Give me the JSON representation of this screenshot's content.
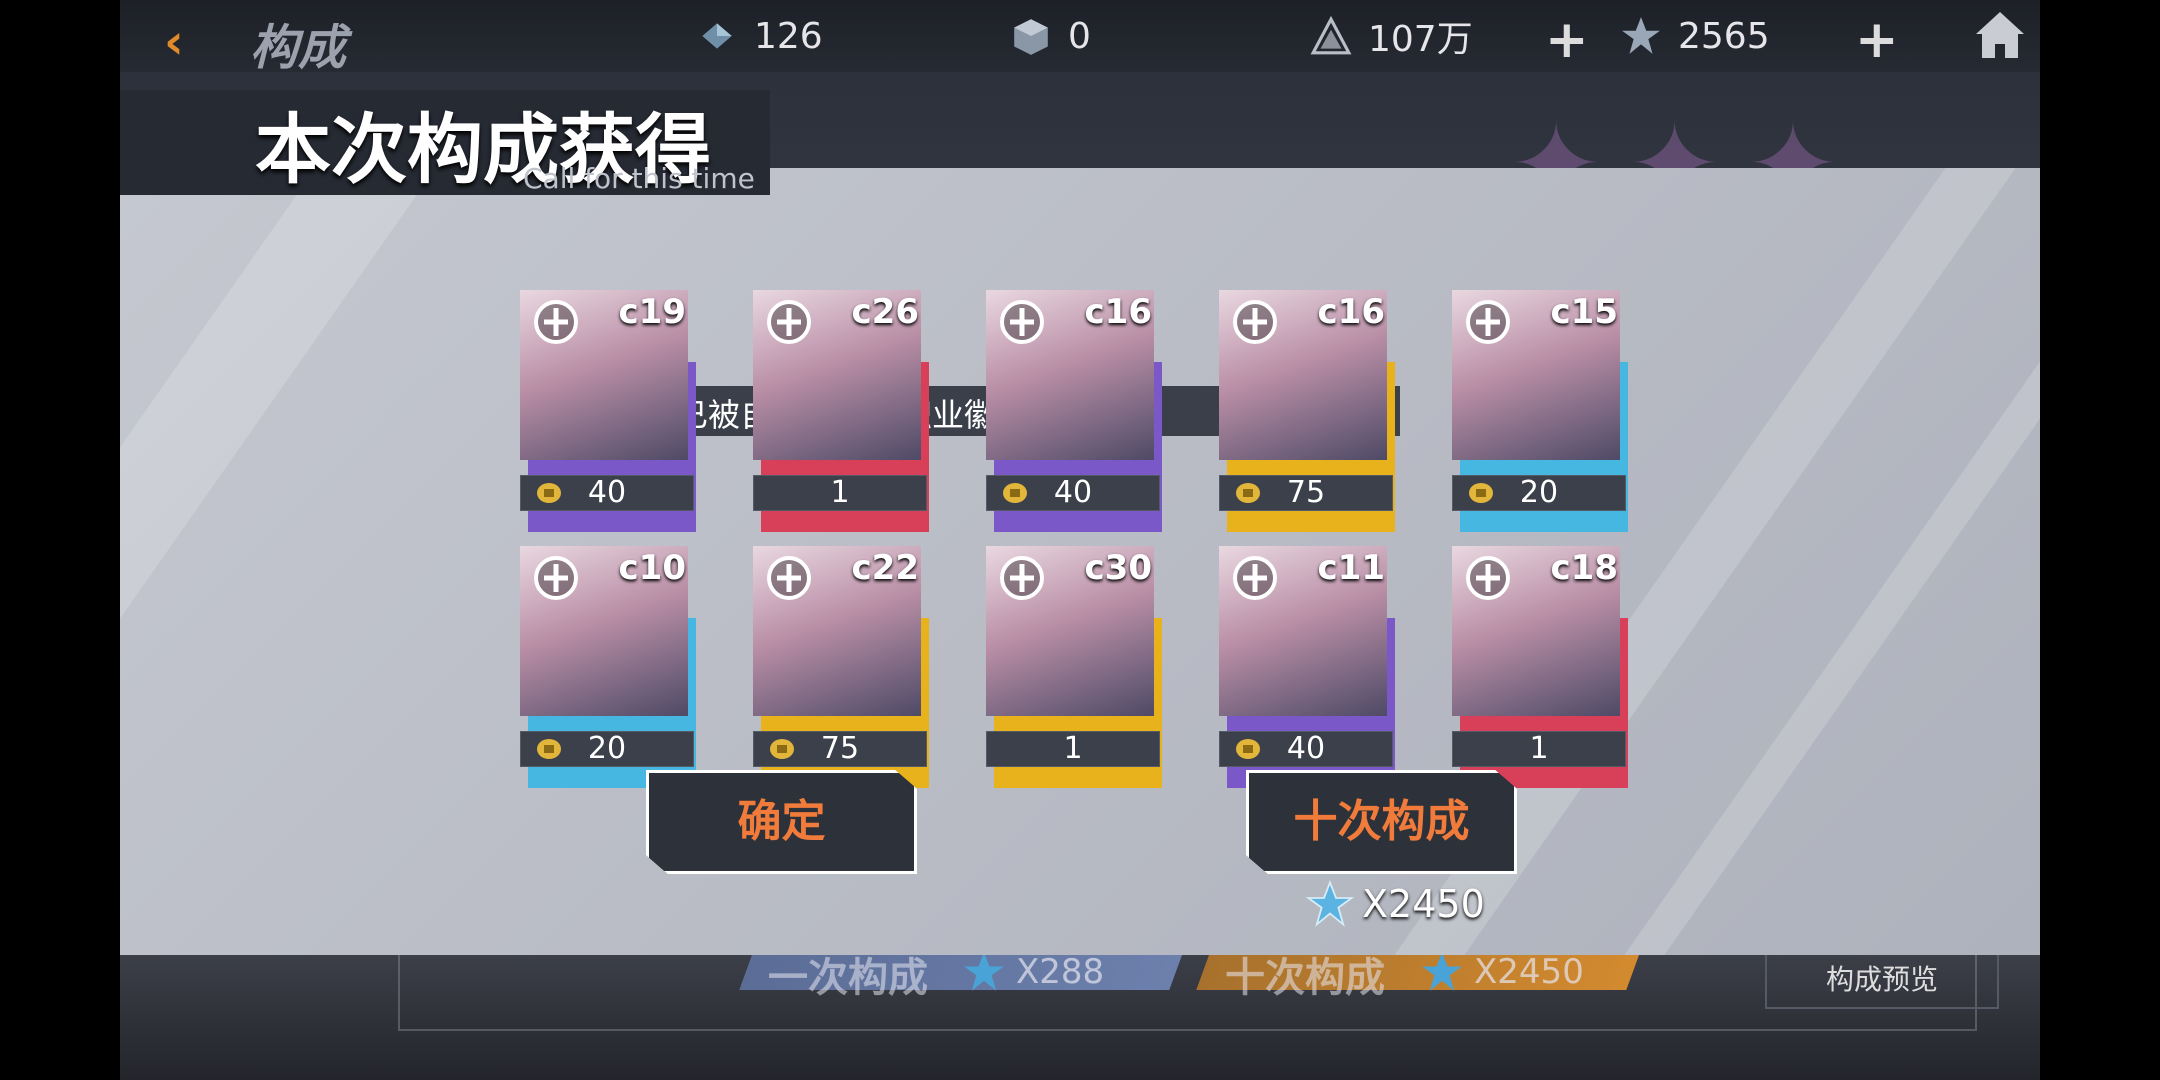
{
  "topbar": {
    "title": "构成",
    "resources": [
      {
        "icon": "crystal-icon",
        "value": "126"
      },
      {
        "icon": "cube-icon",
        "value": "0"
      },
      {
        "icon": "pyramid-coin-icon",
        "value": "107万"
      },
      {
        "icon": "star-crystal-icon",
        "value": "2565"
      }
    ]
  },
  "background": {
    "single_label": "一次构成",
    "single_cost": "X288",
    "ten_label": "十次构成",
    "ten_cost": "X2450",
    "preview_label": "构成预览"
  },
  "modal": {
    "title": "本次构成获得",
    "subtitle": "Call for this time",
    "notice": "重复英雄已被自动分解为职业徽章",
    "confirm_label": "确定",
    "ten_label": "十次构成",
    "ten_cost": "X2450"
  },
  "cards": [
    {
      "code": "c19",
      "class_icon": "shield-cross-icon",
      "count": "40",
      "badge": true,
      "rim": "#7a58c8"
    },
    {
      "code": "c26",
      "class_icon": "gun-icon",
      "count": "1",
      "badge": false,
      "rim": "#d8405a"
    },
    {
      "code": "c16",
      "class_icon": "sword-crest-icon",
      "count": "40",
      "badge": true,
      "rim": "#7a58c8"
    },
    {
      "code": "c16",
      "class_icon": "heart-wings-icon",
      "count": "75",
      "badge": true,
      "rim": "#e7b21c"
    },
    {
      "code": "c15",
      "class_icon": "heart-wings-icon",
      "count": "20",
      "badge": true,
      "rim": "#45b7e0"
    },
    {
      "code": "c10",
      "class_icon": "dagger-icon",
      "count": "20",
      "badge": true,
      "rim": "#45b7e0"
    },
    {
      "code": "c22",
      "class_icon": "horned-skull-icon",
      "count": "75",
      "badge": true,
      "rim": "#e7b21c"
    },
    {
      "code": "c30",
      "class_icon": "flame-icon",
      "count": "1",
      "badge": false,
      "rim": "#e7b21c"
    },
    {
      "code": "c11",
      "class_icon": "dagger-icon",
      "count": "40",
      "badge": true,
      "rim": "#7a58c8"
    },
    {
      "code": "c18",
      "class_icon": "sword-crest-icon",
      "count": "1",
      "badge": false,
      "rim": "#d8405a"
    }
  ]
}
